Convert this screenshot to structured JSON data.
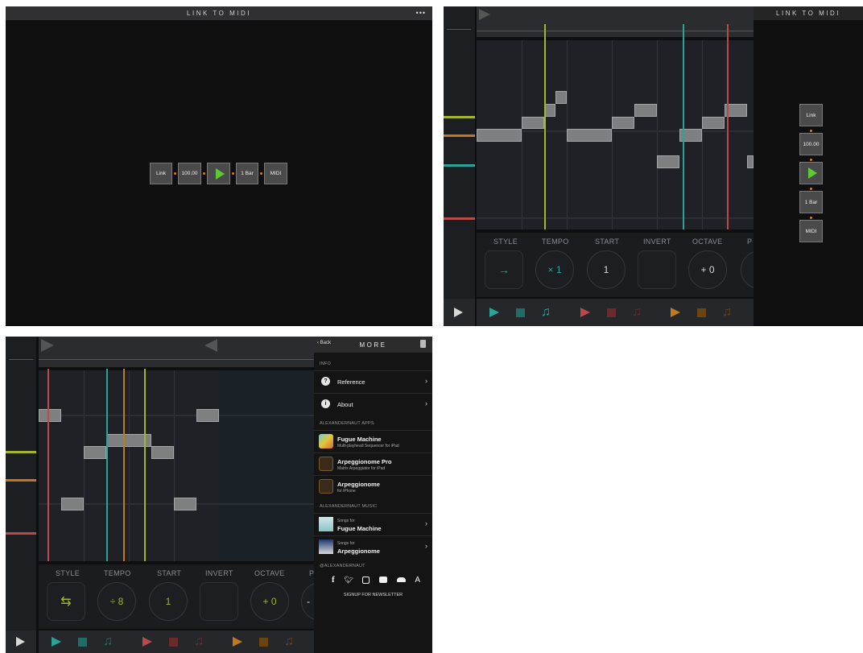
{
  "panel_link": {
    "title": "LINK TO MIDI",
    "menu_dots": "•••",
    "link_label": "Link",
    "tempo": "100.00",
    "bar_label": "1 Bar",
    "midi_label": "MIDI"
  },
  "panel_seq": {
    "side_title": "LINK TO MIDI",
    "link_label": "Link",
    "tempo": "100.00",
    "bar_label": "1 Bar",
    "midi_label": "MIDI",
    "controls": {
      "style": "STYLE",
      "tempo": "TEMPO",
      "start": "START",
      "invert": "INVERT",
      "octave": "OCTAVE",
      "partial": "P"
    },
    "tempo_value": "× 1",
    "start_value": "1",
    "octave_value": "+ 0"
  },
  "panel_more": {
    "controls": {
      "style": "STYLE",
      "tempo": "TEMPO",
      "start": "START",
      "invert": "INVERT",
      "octave": "OCTAVE",
      "partial": "P"
    },
    "tempo_value": "÷ 8",
    "start_value": "1",
    "octave_value": "+ 0",
    "octave_side": "-",
    "menu": {
      "back": "Back",
      "title": "MORE",
      "info_header": "INFO",
      "reference": "Reference",
      "about": "About",
      "apps_header": "ALEXANDERNAUT APPS",
      "apps": [
        {
          "title": "Fugue Machine",
          "subtitle": "Multi-playhead Sequencer for iPad"
        },
        {
          "title": "Arpeggionome Pro",
          "subtitle": "Matrix Arpeggiator for iPad"
        },
        {
          "title": "Arpeggionome",
          "subtitle": "for iPhone"
        }
      ],
      "music_header": "ALEXANDERNAUT MUSIC",
      "music": [
        {
          "prefix": "Songs for",
          "title": "Fugue Machine"
        },
        {
          "prefix": "Songs for",
          "title": "Arpeggionome"
        }
      ],
      "social_header": "@ALEXANDERNAUT",
      "newsletter": "SIGNUP FOR NEWSLETTER",
      "social_icons": [
        "facebook-icon",
        "twitter-icon",
        "instagram-icon",
        "youtube-icon",
        "soundcloud-icon",
        "app-store-icon"
      ]
    }
  },
  "colors": {
    "accent_green": "#5dc933",
    "yellow": "#a3b52a",
    "teal": "#2aa39a",
    "red": "#b84a4a",
    "orange": "#c2781f"
  }
}
